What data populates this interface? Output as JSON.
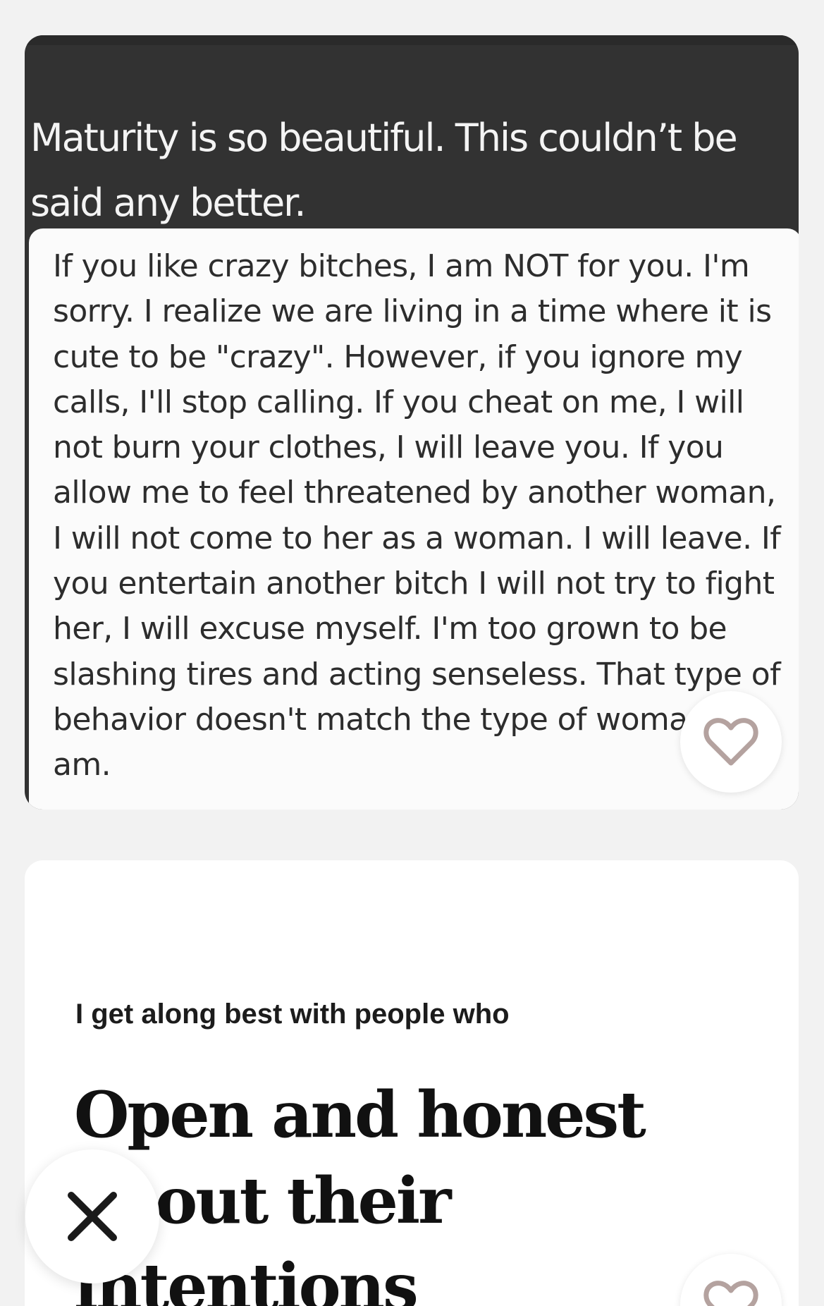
{
  "photo_post": {
    "caption": "Maturity is so beautiful. This couldn’t be said any better.",
    "quote": "If you like crazy bitches, I am NOT for you. I'm sorry. I realize we are living in a time where it is cute to be \"crazy\". However, if you ignore my calls, I'll stop calling. If you cheat on me, I will not burn your clothes, I will leave you. If you allow me to feel threatened by another woman, I will not come to her as a woman. I will leave. If you entertain another bitch I will not try to fight her, I will excuse myself. I'm too grown to be slashing tires and acting senseless. That type of behavior doesn't match the type of woman I am."
  },
  "prompt_post": {
    "question": "I get along best with people who",
    "answer": "Open and honest about their intentions"
  },
  "icons": {
    "like": "heart-icon",
    "skip": "close-icon"
  },
  "colors": {
    "like_icon": "#b4a29f",
    "skip_icon": "#1a1a1a",
    "photo_background": "#323232"
  }
}
